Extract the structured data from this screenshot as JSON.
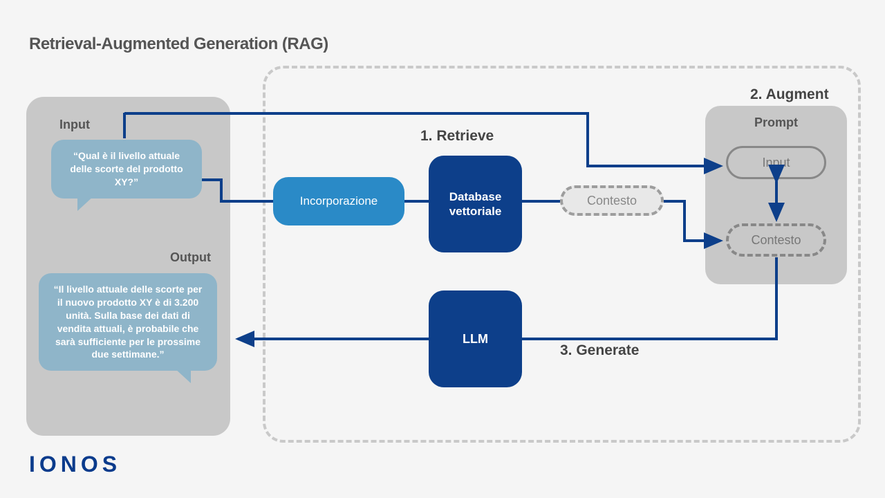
{
  "title": "Retrieval-Augmented Generation (RAG)",
  "logo": "IONOS",
  "io": {
    "input_label": "Input",
    "output_label": "Output",
    "input_text": "“Qual è il livello attuale delle scorte del prodotto XY?”",
    "output_text": "“Il livello attuale delle scorte per il nuovo prodotto XY è di 3.200 unità. Sulla base dei dati di vendita attuali, è probabile che sarà sufficiente per le prossime due settimane.”"
  },
  "steps": {
    "retrieve": "1. Retrieve",
    "augment": "2. Augment",
    "generate": "3. Generate"
  },
  "nodes": {
    "embedding": "Incorporazione",
    "vector_db": "Database vettoriale",
    "context": "Contesto",
    "llm": "LLM"
  },
  "prompt": {
    "title": "Prompt",
    "input": "Input",
    "context": "Contesto"
  }
}
